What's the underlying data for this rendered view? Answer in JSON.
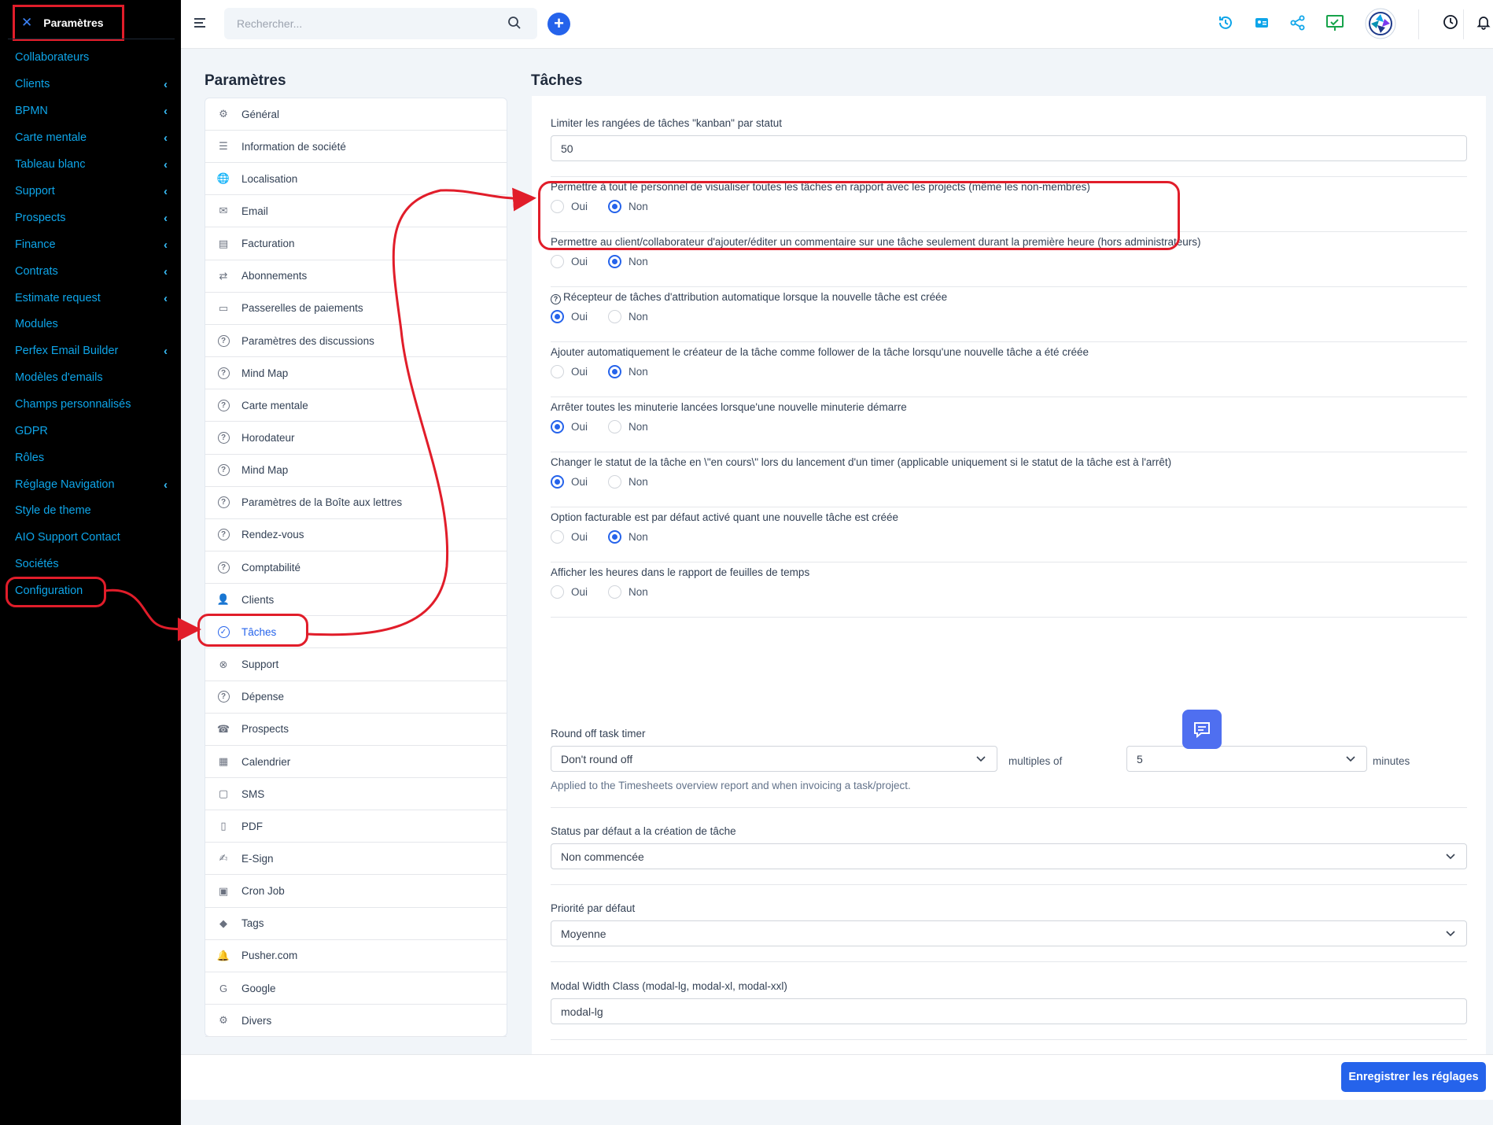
{
  "sidebar": {
    "title": "Paramètres",
    "close_icon": "close-icon",
    "items": [
      {
        "label": "Collaborateurs",
        "chevron": false
      },
      {
        "label": "Clients",
        "chevron": true
      },
      {
        "label": "BPMN",
        "chevron": true
      },
      {
        "label": "Carte mentale",
        "chevron": true
      },
      {
        "label": "Tableau blanc",
        "chevron": true
      },
      {
        "label": "Support",
        "chevron": true
      },
      {
        "label": "Prospects",
        "chevron": true
      },
      {
        "label": "Finance",
        "chevron": true
      },
      {
        "label": "Contrats",
        "chevron": true
      },
      {
        "label": "Estimate request",
        "chevron": true
      },
      {
        "label": "Modules",
        "chevron": false
      },
      {
        "label": "Perfex Email Builder",
        "chevron": true
      },
      {
        "label": "Modèles d'emails",
        "chevron": false
      },
      {
        "label": "Champs personnalisés",
        "chevron": false
      },
      {
        "label": "GDPR",
        "chevron": false
      },
      {
        "label": "Rôles",
        "chevron": false
      },
      {
        "label": "Réglage Navigation",
        "chevron": true
      },
      {
        "label": "Style de theme",
        "chevron": false
      },
      {
        "label": "AIO Support Contact",
        "chevron": false
      },
      {
        "label": "Sociétés",
        "chevron": false
      },
      {
        "label": "Configuration",
        "chevron": false
      }
    ],
    "chevron_glyph": "‹"
  },
  "topbar": {
    "search_placeholder": "Rechercher...",
    "icons": [
      "menu-icon",
      "search-icon",
      "plus-icon",
      "history-icon",
      "id-card-icon",
      "share-icon",
      "presentation-icon",
      "avatar",
      "clock-icon",
      "bell-icon"
    ]
  },
  "settings_menu": {
    "title": "Paramètres",
    "items": [
      {
        "label": "Général",
        "icon": "gear-icon"
      },
      {
        "label": "Information de société",
        "icon": "lines-icon"
      },
      {
        "label": "Localisation",
        "icon": "globe-icon"
      },
      {
        "label": "Email",
        "icon": "envelope-icon"
      },
      {
        "label": "Facturation",
        "icon": "invoice-icon"
      },
      {
        "label": "Abonnements",
        "icon": "repeat-icon"
      },
      {
        "label": "Passerelles de paiements",
        "icon": "credit-card-icon"
      },
      {
        "label": "Paramètres des discussions",
        "icon": "question-icon"
      },
      {
        "label": "Mind Map",
        "icon": "question-icon"
      },
      {
        "label": "Carte mentale",
        "icon": "question-icon"
      },
      {
        "label": "Horodateur",
        "icon": "question-icon"
      },
      {
        "label": "Mind Map",
        "icon": "question-icon"
      },
      {
        "label": "Paramètres de la Boîte aux lettres",
        "icon": "question-icon"
      },
      {
        "label": "Rendez-vous",
        "icon": "question-icon"
      },
      {
        "label": "Comptabilité",
        "icon": "question-icon"
      },
      {
        "label": "Clients",
        "icon": "user-icon"
      },
      {
        "label": "Tâches",
        "icon": "check-circle-icon",
        "active": true
      },
      {
        "label": "Support",
        "icon": "lifebuoy-icon"
      },
      {
        "label": "Dépense",
        "icon": "question-icon"
      },
      {
        "label": "Prospects",
        "icon": "tty-icon"
      },
      {
        "label": "Calendrier",
        "icon": "calendar-icon"
      },
      {
        "label": "SMS",
        "icon": "message-icon"
      },
      {
        "label": "PDF",
        "icon": "pdf-icon"
      },
      {
        "label": "E-Sign",
        "icon": "signature-icon"
      },
      {
        "label": "Cron Job",
        "icon": "cpu-icon"
      },
      {
        "label": "Tags",
        "icon": "tags-icon"
      },
      {
        "label": "Pusher.com",
        "icon": "bell-icon"
      },
      {
        "label": "Google",
        "icon": "google-icon"
      },
      {
        "label": "Divers",
        "icon": "cogs-icon"
      }
    ]
  },
  "tasks": {
    "title": "Tâches",
    "kanban_label": "Limiter les rangées de tâches \"kanban\" par statut",
    "kanban_value": "50",
    "yes": "Oui",
    "no": "Non",
    "options": [
      {
        "label": "Permettre à tout le personnel de visualiser toutes les tâches en rapport avec les projects (même les non-membres)",
        "value": "Non"
      },
      {
        "label": "Permettre au client/collaborateur d'ajouter/éditer un commentaire sur une tâche seulement durant la première heure (hors administrateurs)",
        "value": "Non"
      },
      {
        "label": "Récepteur de tâches d'attribution automatique lorsque la nouvelle tâche est créée",
        "value": "Oui",
        "help_icon": true
      },
      {
        "label": "Ajouter automatiquement le créateur de la tâche comme follower de la tâche lorsqu'une nouvelle tâche a été créée",
        "value": "Non"
      },
      {
        "label": "Arrêter toutes les minuterie lancées lorsque'une nouvelle minuterie démarre",
        "value": "Oui"
      },
      {
        "label": "Changer le statut de la tâche en \\\"en cours\\\" lors du lancement d'un timer (applicable uniquement si le statut de la tâche est à l'arrêt)",
        "value": "Oui"
      },
      {
        "label": "Option facturable est par défaut activé quant une nouvelle tâche est créée",
        "value": "Non"
      },
      {
        "label": "Afficher les heures dans le rapport de feuilles de temps",
        "value": ""
      }
    ],
    "round_label": "Round off task timer",
    "round_value": "Don't round off",
    "multiples_label": "multiples of",
    "multiples_value": "5",
    "minutes_label": "minutes",
    "round_hint": "Applied to the Timesheets overview report and when invoicing a task/project.",
    "status_label": "Status par défaut a la création de tâche",
    "status_value": "Non commencée",
    "priority_label": "Priorité par défaut",
    "priority_value": "Moyenne",
    "modal_label": "Modal Width Class (modal-lg, modal-xl, modal-xxl)",
    "modal_value": "modal-lg"
  },
  "footer": {
    "save_label": "Enregistrer les réglages"
  },
  "colors": {
    "accent": "#2563eb",
    "sidebar_bg": "#000000",
    "sidebar_link": "#0ea5e9",
    "annotation_red": "#e11d2a"
  }
}
